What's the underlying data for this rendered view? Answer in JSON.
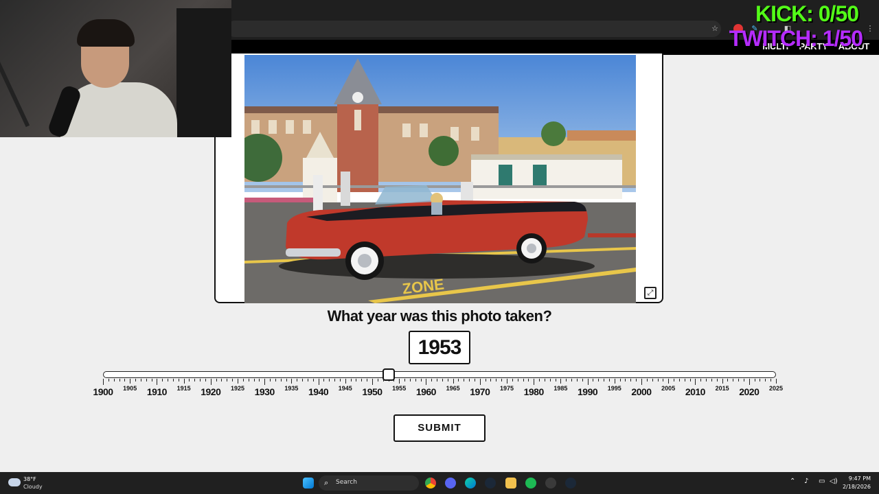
{
  "overlay": {
    "kick": "KICK: 0/50",
    "twitch": "TWITCH: 1/50"
  },
  "nav": {
    "links": [
      "MULTI",
      "PARTY",
      "ABOUT"
    ]
  },
  "game": {
    "question": "What year was this photo taken?",
    "selected_year": "1953",
    "slider": {
      "min": 1900,
      "max": 2025,
      "value": 1953,
      "major_labels": [
        "1900",
        "1910",
        "1920",
        "1930",
        "1940",
        "1950",
        "1960",
        "1970",
        "1980",
        "1990",
        "2000",
        "2010",
        "2020"
      ],
      "minor_labels": [
        "1905",
        "1915",
        "1925",
        "1935",
        "1945",
        "1955",
        "1965",
        "1975",
        "1985",
        "1995",
        "2005",
        "2015",
        "2025"
      ]
    },
    "submit_label": "SUBMIT",
    "photo_text": "ZONE"
  },
  "taskbar": {
    "weather_temp": "38°F",
    "weather_condition": "Cloudy",
    "search_placeholder": "Search",
    "time": "9:47 PM",
    "date": "2/18/2026"
  },
  "colors": {
    "kick": "#53fc18",
    "twitch": "#b52cff",
    "car_red": "#c0392b"
  }
}
